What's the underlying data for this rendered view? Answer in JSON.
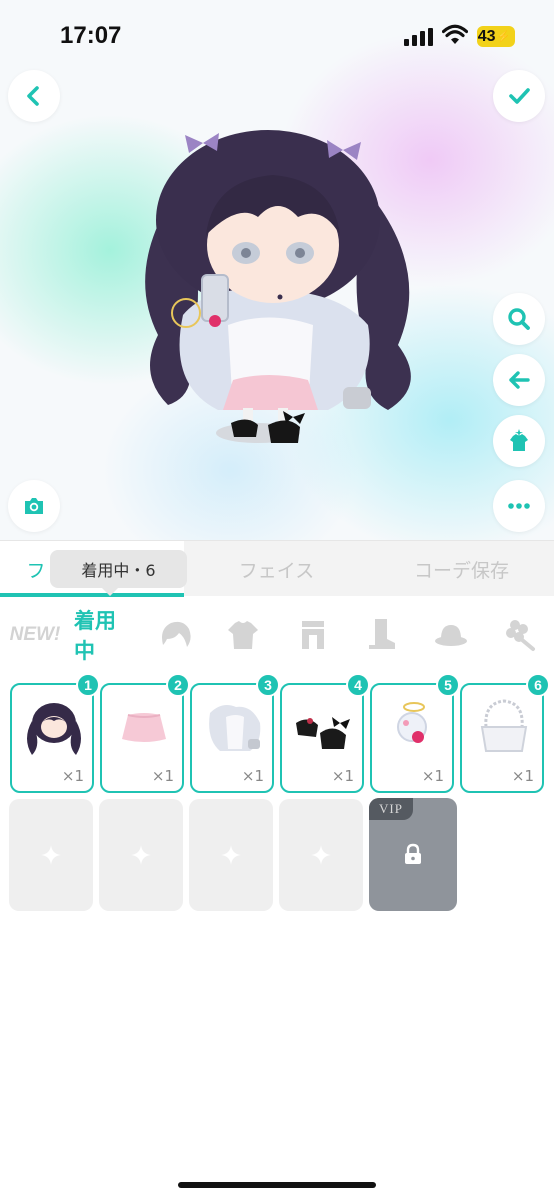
{
  "status_bar": {
    "time": "17:07",
    "battery": "43"
  },
  "tabs": [
    {
      "label": "ファッション",
      "shown": "フ"
    },
    {
      "label": "フェイス"
    },
    {
      "label": "コーデ保存"
    }
  ],
  "tooltip": "着用中・6",
  "categories": {
    "new_label": "NEW!",
    "wearing_label": "着用中",
    "icons": [
      "hair-icon",
      "tshirt-icon",
      "skirt-icon",
      "boots-icon",
      "hat-icon",
      "flower-icon"
    ]
  },
  "worn_items": [
    {
      "badge": "1",
      "qty": "×1",
      "icon": "twin-tail-hair"
    },
    {
      "badge": "2",
      "qty": "×1",
      "icon": "pink-skirt"
    },
    {
      "badge": "3",
      "qty": "×1",
      "icon": "hoodie-outfit"
    },
    {
      "badge": "4",
      "qty": "×1",
      "icon": "black-heels"
    },
    {
      "badge": "5",
      "qty": "×1",
      "icon": "phone-accessory"
    },
    {
      "badge": "6",
      "qty": "×1",
      "icon": "pearl-bag"
    }
  ],
  "empty_slots": 4,
  "vip_label": "VIP",
  "colors": {
    "accent": "#1fc3b3",
    "battery": "#f2d21a",
    "vip_slot": "#8f949b"
  }
}
